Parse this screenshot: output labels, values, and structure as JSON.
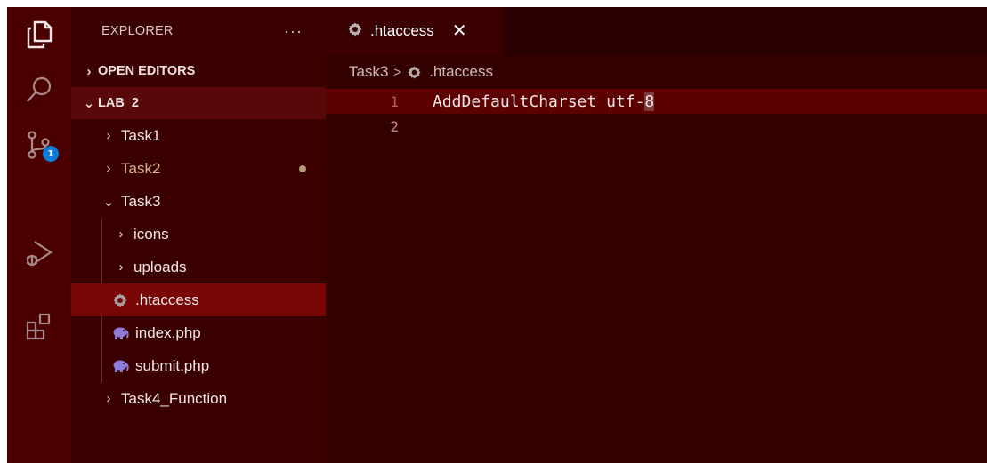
{
  "activity_bar": {
    "items": [
      {
        "icon": "files-icon"
      },
      {
        "icon": "search-icon"
      },
      {
        "icon": "source-control-icon",
        "badge": "1"
      },
      {
        "icon": "run-debug-icon"
      },
      {
        "icon": "extensions-icon"
      }
    ]
  },
  "sidebar": {
    "title": "EXPLORER",
    "more": "···",
    "open_editors": "OPEN EDITORS",
    "workspace": "LAB_2",
    "tree": {
      "task1": "Task1",
      "task2": "Task2",
      "task3": "Task3",
      "icons": "icons",
      "uploads": "uploads",
      "htaccess": ".htaccess",
      "index": "index.php",
      "submit": "submit.php",
      "task4": "Task4_Function"
    }
  },
  "editor": {
    "tab": {
      "label": ".htaccess",
      "close": "✕"
    },
    "breadcrumb": {
      "folder": "Task3",
      "separator": ">",
      "file": ".htaccess"
    },
    "lines": [
      {
        "number": "1",
        "text_main": "AddDefaultCharset utf-",
        "text_cursor": "8"
      },
      {
        "number": "2",
        "text_main": "",
        "text_cursor": ""
      }
    ]
  },
  "colors": {
    "activity_bg": "#4b0000",
    "sidebar_bg": "#3a0000",
    "editor_bg": "#330000",
    "selection": "#7a0505",
    "badge": "#0e7ad4"
  }
}
